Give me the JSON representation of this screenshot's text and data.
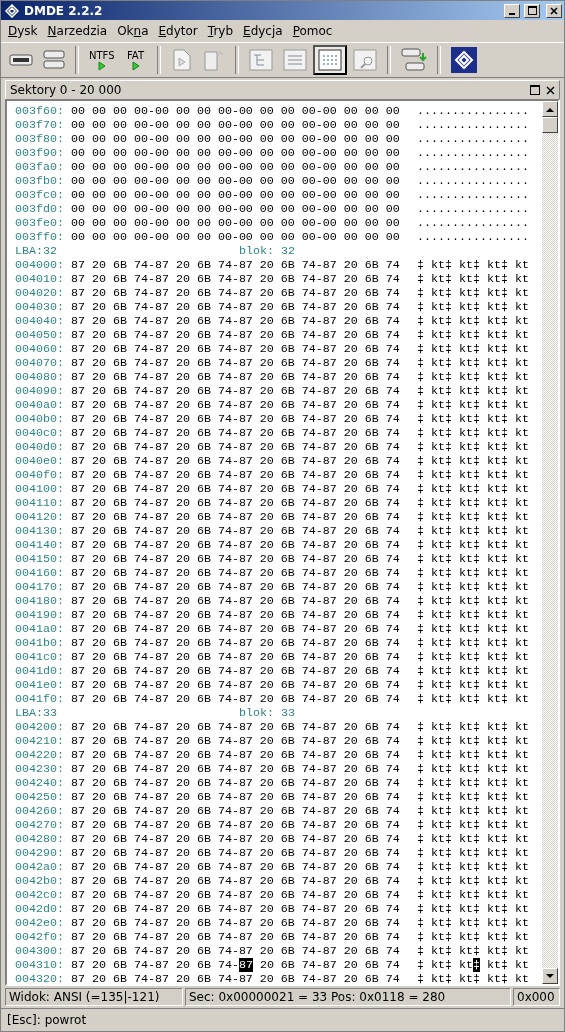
{
  "window": {
    "title": "DMDE 2.2.2"
  },
  "menu": [
    {
      "key": "D",
      "post": "ysk"
    },
    {
      "key": "N",
      "post": "arzedzia"
    },
    {
      "pre": "Ok",
      "key": "n",
      "post": "a"
    },
    {
      "key": "E",
      "post": "dytor"
    },
    {
      "key": "T",
      "post": "ryb"
    },
    {
      "key": "E",
      "post": "dycja"
    },
    {
      "key": "P",
      "post": "omoc"
    }
  ],
  "toolbar": [
    {
      "kind": "drive",
      "selected": false
    },
    {
      "kind": "drives",
      "selected": false
    },
    {
      "kind": "sep"
    },
    {
      "kind": "fs",
      "label": "NTFS",
      "selected": false
    },
    {
      "kind": "fs",
      "label": "FAT",
      "selected": false
    },
    {
      "kind": "sep"
    },
    {
      "kind": "doc",
      "selected": false
    },
    {
      "kind": "docnew",
      "selected": false
    },
    {
      "kind": "sep"
    },
    {
      "kind": "tree",
      "selected": false
    },
    {
      "kind": "list",
      "selected": false
    },
    {
      "kind": "grid",
      "selected": true
    },
    {
      "kind": "find",
      "selected": false
    },
    {
      "kind": "sep"
    },
    {
      "kind": "copy",
      "selected": false
    },
    {
      "kind": "sep"
    },
    {
      "kind": "logo",
      "selected": false
    }
  ],
  "pane": {
    "title": "Sektory 0 - 20 000"
  },
  "rows": [
    {
      "kind": "hex",
      "address": "003f60:",
      "hex": [
        {
          "text": "00 00 00 00-00 00 00 00-00 00 00 00-00 00 00 00",
          "selected": false
        }
      ],
      "ascii": [
        {
          "text": "................",
          "selected": false
        }
      ]
    },
    {
      "kind": "hex",
      "address": "003f70:",
      "hex": [
        {
          "text": "00 00 00 00-00 00 00 00-00 00 00 00-00 00 00 00",
          "selected": false
        }
      ],
      "ascii": [
        {
          "text": "................",
          "selected": false
        }
      ]
    },
    {
      "kind": "hex",
      "address": "003f80:",
      "hex": [
        {
          "text": "00 00 00 00-00 00 00 00-00 00 00 00-00 00 00 00",
          "selected": false
        }
      ],
      "ascii": [
        {
          "text": "................",
          "selected": false
        }
      ]
    },
    {
      "kind": "hex",
      "address": "003f90:",
      "hex": [
        {
          "text": "00 00 00 00-00 00 00 00-00 00 00 00-00 00 00 00",
          "selected": false
        }
      ],
      "ascii": [
        {
          "text": "................",
          "selected": false
        }
      ]
    },
    {
      "kind": "hex",
      "address": "003fa0:",
      "hex": [
        {
          "text": "00 00 00 00-00 00 00 00-00 00 00 00-00 00 00 00",
          "selected": false
        }
      ],
      "ascii": [
        {
          "text": "................",
          "selected": false
        }
      ]
    },
    {
      "kind": "hex",
      "address": "003fb0:",
      "hex": [
        {
          "text": "00 00 00 00-00 00 00 00-00 00 00 00-00 00 00 00",
          "selected": false
        }
      ],
      "ascii": [
        {
          "text": "................",
          "selected": false
        }
      ]
    },
    {
      "kind": "hex",
      "address": "003fc0:",
      "hex": [
        {
          "text": "00 00 00 00-00 00 00 00-00 00 00 00-00 00 00 00",
          "selected": false
        }
      ],
      "ascii": [
        {
          "text": "................",
          "selected": false
        }
      ]
    },
    {
      "kind": "hex",
      "address": "003fd0:",
      "hex": [
        {
          "text": "00 00 00 00-00 00 00 00-00 00 00 00-00 00 00 00",
          "selected": false
        }
      ],
      "ascii": [
        {
          "text": "................",
          "selected": false
        }
      ]
    },
    {
      "kind": "hex",
      "address": "003fe0:",
      "hex": [
        {
          "text": "00 00 00 00-00 00 00 00-00 00 00 00-00 00 00 00",
          "selected": false
        }
      ],
      "ascii": [
        {
          "text": "................",
          "selected": false
        }
      ]
    },
    {
      "kind": "hex",
      "address": "003ff0:",
      "hex": [
        {
          "text": "00 00 00 00-00 00 00 00-00 00 00 00-00 00 00 00",
          "selected": false
        }
      ],
      "ascii": [
        {
          "text": "................",
          "selected": false
        }
      ]
    },
    {
      "kind": "sector",
      "lba": "LBA:32",
      "block": "blok: 32"
    },
    {
      "kind": "hex",
      "address": "004000:",
      "hex": [
        {
          "text": "87 20 6B 74-87 20 6B 74-87 20 6B 74-87 20 6B 74",
          "selected": false
        }
      ],
      "ascii": [
        {
          "text": "‡ kt‡ kt‡ kt‡ kt",
          "selected": false
        }
      ]
    },
    {
      "kind": "hex",
      "address": "004010:",
      "hex": [
        {
          "text": "87 20 6B 74-87 20 6B 74-87 20 6B 74-87 20 6B 74",
          "selected": false
        }
      ],
      "ascii": [
        {
          "text": "‡ kt‡ kt‡ kt‡ kt",
          "selected": false
        }
      ]
    },
    {
      "kind": "hex",
      "address": "004020:",
      "hex": [
        {
          "text": "87 20 6B 74-87 20 6B 74-87 20 6B 74-87 20 6B 74",
          "selected": false
        }
      ],
      "ascii": [
        {
          "text": "‡ kt‡ kt‡ kt‡ kt",
          "selected": false
        }
      ]
    },
    {
      "kind": "hex",
      "address": "004030:",
      "hex": [
        {
          "text": "87 20 6B 74-87 20 6B 74-87 20 6B 74-87 20 6B 74",
          "selected": false
        }
      ],
      "ascii": [
        {
          "text": "‡ kt‡ kt‡ kt‡ kt",
          "selected": false
        }
      ]
    },
    {
      "kind": "hex",
      "address": "004040:",
      "hex": [
        {
          "text": "87 20 6B 74-87 20 6B 74-87 20 6B 74-87 20 6B 74",
          "selected": false
        }
      ],
      "ascii": [
        {
          "text": "‡ kt‡ kt‡ kt‡ kt",
          "selected": false
        }
      ]
    },
    {
      "kind": "hex",
      "address": "004050:",
      "hex": [
        {
          "text": "87 20 6B 74-87 20 6B 74-87 20 6B 74-87 20 6B 74",
          "selected": false
        }
      ],
      "ascii": [
        {
          "text": "‡ kt‡ kt‡ kt‡ kt",
          "selected": false
        }
      ]
    },
    {
      "kind": "hex",
      "address": "004060:",
      "hex": [
        {
          "text": "87 20 6B 74-87 20 6B 74-87 20 6B 74-87 20 6B 74",
          "selected": false
        }
      ],
      "ascii": [
        {
          "text": "‡ kt‡ kt‡ kt‡ kt",
          "selected": false
        }
      ]
    },
    {
      "kind": "hex",
      "address": "004070:",
      "hex": [
        {
          "text": "87 20 6B 74-87 20 6B 74-87 20 6B 74-87 20 6B 74",
          "selected": false
        }
      ],
      "ascii": [
        {
          "text": "‡ kt‡ kt‡ kt‡ kt",
          "selected": false
        }
      ]
    },
    {
      "kind": "hex",
      "address": "004080:",
      "hex": [
        {
          "text": "87 20 6B 74-87 20 6B 74-87 20 6B 74-87 20 6B 74",
          "selected": false
        }
      ],
      "ascii": [
        {
          "text": "‡ kt‡ kt‡ kt‡ kt",
          "selected": false
        }
      ]
    },
    {
      "kind": "hex",
      "address": "004090:",
      "hex": [
        {
          "text": "87 20 6B 74-87 20 6B 74-87 20 6B 74-87 20 6B 74",
          "selected": false
        }
      ],
      "ascii": [
        {
          "text": "‡ kt‡ kt‡ kt‡ kt",
          "selected": false
        }
      ]
    },
    {
      "kind": "hex",
      "address": "0040a0:",
      "hex": [
        {
          "text": "87 20 6B 74-87 20 6B 74-87 20 6B 74-87 20 6B 74",
          "selected": false
        }
      ],
      "ascii": [
        {
          "text": "‡ kt‡ kt‡ kt‡ kt",
          "selected": false
        }
      ]
    },
    {
      "kind": "hex",
      "address": "0040b0:",
      "hex": [
        {
          "text": "87 20 6B 74-87 20 6B 74-87 20 6B 74-87 20 6B 74",
          "selected": false
        }
      ],
      "ascii": [
        {
          "text": "‡ kt‡ kt‡ kt‡ kt",
          "selected": false
        }
      ]
    },
    {
      "kind": "hex",
      "address": "0040c0:",
      "hex": [
        {
          "text": "87 20 6B 74-87 20 6B 74-87 20 6B 74-87 20 6B 74",
          "selected": false
        }
      ],
      "ascii": [
        {
          "text": "‡ kt‡ kt‡ kt‡ kt",
          "selected": false
        }
      ]
    },
    {
      "kind": "hex",
      "address": "0040d0:",
      "hex": [
        {
          "text": "87 20 6B 74-87 20 6B 74-87 20 6B 74-87 20 6B 74",
          "selected": false
        }
      ],
      "ascii": [
        {
          "text": "‡ kt‡ kt‡ kt‡ kt",
          "selected": false
        }
      ]
    },
    {
      "kind": "hex",
      "address": "0040e0:",
      "hex": [
        {
          "text": "87 20 6B 74-87 20 6B 74-87 20 6B 74-87 20 6B 74",
          "selected": false
        }
      ],
      "ascii": [
        {
          "text": "‡ kt‡ kt‡ kt‡ kt",
          "selected": false
        }
      ]
    },
    {
      "kind": "hex",
      "address": "0040f0:",
      "hex": [
        {
          "text": "87 20 6B 74-87 20 6B 74-87 20 6B 74-87 20 6B 74",
          "selected": false
        }
      ],
      "ascii": [
        {
          "text": "‡ kt‡ kt‡ kt‡ kt",
          "selected": false
        }
      ]
    },
    {
      "kind": "hex",
      "address": "004100:",
      "hex": [
        {
          "text": "87 20 6B 74-87 20 6B 74-87 20 6B 74-87 20 6B 74",
          "selected": false
        }
      ],
      "ascii": [
        {
          "text": "‡ kt‡ kt‡ kt‡ kt",
          "selected": false
        }
      ]
    },
    {
      "kind": "hex",
      "address": "004110:",
      "hex": [
        {
          "text": "87 20 6B 74-87 20 6B 74-87 20 6B 74-87 20 6B 74",
          "selected": false
        }
      ],
      "ascii": [
        {
          "text": "‡ kt‡ kt‡ kt‡ kt",
          "selected": false
        }
      ]
    },
    {
      "kind": "hex",
      "address": "004120:",
      "hex": [
        {
          "text": "87 20 6B 74-87 20 6B 74-87 20 6B 74-87 20 6B 74",
          "selected": false
        }
      ],
      "ascii": [
        {
          "text": "‡ kt‡ kt‡ kt‡ kt",
          "selected": false
        }
      ]
    },
    {
      "kind": "hex",
      "address": "004130:",
      "hex": [
        {
          "text": "87 20 6B 74-87 20 6B 74-87 20 6B 74-87 20 6B 74",
          "selected": false
        }
      ],
      "ascii": [
        {
          "text": "‡ kt‡ kt‡ kt‡ kt",
          "selected": false
        }
      ]
    },
    {
      "kind": "hex",
      "address": "004140:",
      "hex": [
        {
          "text": "87 20 6B 74-87 20 6B 74-87 20 6B 74-87 20 6B 74",
          "selected": false
        }
      ],
      "ascii": [
        {
          "text": "‡ kt‡ kt‡ kt‡ kt",
          "selected": false
        }
      ]
    },
    {
      "kind": "hex",
      "address": "004150:",
      "hex": [
        {
          "text": "87 20 6B 74-87 20 6B 74-87 20 6B 74-87 20 6B 74",
          "selected": false
        }
      ],
      "ascii": [
        {
          "text": "‡ kt‡ kt‡ kt‡ kt",
          "selected": false
        }
      ]
    },
    {
      "kind": "hex",
      "address": "004160:",
      "hex": [
        {
          "text": "87 20 6B 74-87 20 6B 74-87 20 6B 74-87 20 6B 74",
          "selected": false
        }
      ],
      "ascii": [
        {
          "text": "‡ kt‡ kt‡ kt‡ kt",
          "selected": false
        }
      ]
    },
    {
      "kind": "hex",
      "address": "004170:",
      "hex": [
        {
          "text": "87 20 6B 74-87 20 6B 74-87 20 6B 74-87 20 6B 74",
          "selected": false
        }
      ],
      "ascii": [
        {
          "text": "‡ kt‡ kt‡ kt‡ kt",
          "selected": false
        }
      ]
    },
    {
      "kind": "hex",
      "address": "004180:",
      "hex": [
        {
          "text": "87 20 6B 74-87 20 6B 74-87 20 6B 74-87 20 6B 74",
          "selected": false
        }
      ],
      "ascii": [
        {
          "text": "‡ kt‡ kt‡ kt‡ kt",
          "selected": false
        }
      ]
    },
    {
      "kind": "hex",
      "address": "004190:",
      "hex": [
        {
          "text": "87 20 6B 74-87 20 6B 74-87 20 6B 74-87 20 6B 74",
          "selected": false
        }
      ],
      "ascii": [
        {
          "text": "‡ kt‡ kt‡ kt‡ kt",
          "selected": false
        }
      ]
    },
    {
      "kind": "hex",
      "address": "0041a0:",
      "hex": [
        {
          "text": "87 20 6B 74-87 20 6B 74-87 20 6B 74-87 20 6B 74",
          "selected": false
        }
      ],
      "ascii": [
        {
          "text": "‡ kt‡ kt‡ kt‡ kt",
          "selected": false
        }
      ]
    },
    {
      "kind": "hex",
      "address": "0041b0:",
      "hex": [
        {
          "text": "87 20 6B 74-87 20 6B 74-87 20 6B 74-87 20 6B 74",
          "selected": false
        }
      ],
      "ascii": [
        {
          "text": "‡ kt‡ kt‡ kt‡ kt",
          "selected": false
        }
      ]
    },
    {
      "kind": "hex",
      "address": "0041c0:",
      "hex": [
        {
          "text": "87 20 6B 74-87 20 6B 74-87 20 6B 74-87 20 6B 74",
          "selected": false
        }
      ],
      "ascii": [
        {
          "text": "‡ kt‡ kt‡ kt‡ kt",
          "selected": false
        }
      ]
    },
    {
      "kind": "hex",
      "address": "0041d0:",
      "hex": [
        {
          "text": "87 20 6B 74-87 20 6B 74-87 20 6B 74-87 20 6B 74",
          "selected": false
        }
      ],
      "ascii": [
        {
          "text": "‡ kt‡ kt‡ kt‡ kt",
          "selected": false
        }
      ]
    },
    {
      "kind": "hex",
      "address": "0041e0:",
      "hex": [
        {
          "text": "87 20 6B 74-87 20 6B 74-87 20 6B 74-87 20 6B 74",
          "selected": false
        }
      ],
      "ascii": [
        {
          "text": "‡ kt‡ kt‡ kt‡ kt",
          "selected": false
        }
      ]
    },
    {
      "kind": "hex",
      "address": "0041f0:",
      "hex": [
        {
          "text": "87 20 6B 74-87 20 6B 74-87 20 6B 74-87 20 6B 74",
          "selected": false
        }
      ],
      "ascii": [
        {
          "text": "‡ kt‡ kt‡ kt‡ kt",
          "selected": false
        }
      ]
    },
    {
      "kind": "sector",
      "lba": "LBA:33",
      "block": "blok: 33"
    },
    {
      "kind": "hex",
      "address": "004200:",
      "hex": [
        {
          "text": "87 20 6B 74-87 20 6B 74-87 20 6B 74-87 20 6B 74",
          "selected": false
        }
      ],
      "ascii": [
        {
          "text": "‡ kt‡ kt‡ kt‡ kt",
          "selected": false
        }
      ]
    },
    {
      "kind": "hex",
      "address": "004210:",
      "hex": [
        {
          "text": "87 20 6B 74-87 20 6B 74-87 20 6B 74-87 20 6B 74",
          "selected": false
        }
      ],
      "ascii": [
        {
          "text": "‡ kt‡ kt‡ kt‡ kt",
          "selected": false
        }
      ]
    },
    {
      "kind": "hex",
      "address": "004220:",
      "hex": [
        {
          "text": "87 20 6B 74-87 20 6B 74-87 20 6B 74-87 20 6B 74",
          "selected": false
        }
      ],
      "ascii": [
        {
          "text": "‡ kt‡ kt‡ kt‡ kt",
          "selected": false
        }
      ]
    },
    {
      "kind": "hex",
      "address": "004230:",
      "hex": [
        {
          "text": "87 20 6B 74-87 20 6B 74-87 20 6B 74-87 20 6B 74",
          "selected": false
        }
      ],
      "ascii": [
        {
          "text": "‡ kt‡ kt‡ kt‡ kt",
          "selected": false
        }
      ]
    },
    {
      "kind": "hex",
      "address": "004240:",
      "hex": [
        {
          "text": "87 20 6B 74-87 20 6B 74-87 20 6B 74-87 20 6B 74",
          "selected": false
        }
      ],
      "ascii": [
        {
          "text": "‡ kt‡ kt‡ kt‡ kt",
          "selected": false
        }
      ]
    },
    {
      "kind": "hex",
      "address": "004250:",
      "hex": [
        {
          "text": "87 20 6B 74-87 20 6B 74-87 20 6B 74-87 20 6B 74",
          "selected": false
        }
      ],
      "ascii": [
        {
          "text": "‡ kt‡ kt‡ kt‡ kt",
          "selected": false
        }
      ]
    },
    {
      "kind": "hex",
      "address": "004260:",
      "hex": [
        {
          "text": "87 20 6B 74-87 20 6B 74-87 20 6B 74-87 20 6B 74",
          "selected": false
        }
      ],
      "ascii": [
        {
          "text": "‡ kt‡ kt‡ kt‡ kt",
          "selected": false
        }
      ]
    },
    {
      "kind": "hex",
      "address": "004270:",
      "hex": [
        {
          "text": "87 20 6B 74-87 20 6B 74-87 20 6B 74-87 20 6B 74",
          "selected": false
        }
      ],
      "ascii": [
        {
          "text": "‡ kt‡ kt‡ kt‡ kt",
          "selected": false
        }
      ]
    },
    {
      "kind": "hex",
      "address": "004280:",
      "hex": [
        {
          "text": "87 20 6B 74-87 20 6B 74-87 20 6B 74-87 20 6B 74",
          "selected": false
        }
      ],
      "ascii": [
        {
          "text": "‡ kt‡ kt‡ kt‡ kt",
          "selected": false
        }
      ]
    },
    {
      "kind": "hex",
      "address": "004290:",
      "hex": [
        {
          "text": "87 20 6B 74-87 20 6B 74-87 20 6B 74-87 20 6B 74",
          "selected": false
        }
      ],
      "ascii": [
        {
          "text": "‡ kt‡ kt‡ kt‡ kt",
          "selected": false
        }
      ]
    },
    {
      "kind": "hex",
      "address": "0042a0:",
      "hex": [
        {
          "text": "87 20 6B 74-87 20 6B 74-87 20 6B 74-87 20 6B 74",
          "selected": false
        }
      ],
      "ascii": [
        {
          "text": "‡ kt‡ kt‡ kt‡ kt",
          "selected": false
        }
      ]
    },
    {
      "kind": "hex",
      "address": "0042b0:",
      "hex": [
        {
          "text": "87 20 6B 74-87 20 6B 74-87 20 6B 74-87 20 6B 74",
          "selected": false
        }
      ],
      "ascii": [
        {
          "text": "‡ kt‡ kt‡ kt‡ kt",
          "selected": false
        }
      ]
    },
    {
      "kind": "hex",
      "address": "0042c0:",
      "hex": [
        {
          "text": "87 20 6B 74-87 20 6B 74-87 20 6B 74-87 20 6B 74",
          "selected": false
        }
      ],
      "ascii": [
        {
          "text": "‡ kt‡ kt‡ kt‡ kt",
          "selected": false
        }
      ]
    },
    {
      "kind": "hex",
      "address": "0042d0:",
      "hex": [
        {
          "text": "87 20 6B 74-87 20 6B 74-87 20 6B 74-87 20 6B 74",
          "selected": false
        }
      ],
      "ascii": [
        {
          "text": "‡ kt‡ kt‡ kt‡ kt",
          "selected": false
        }
      ]
    },
    {
      "kind": "hex",
      "address": "0042e0:",
      "hex": [
        {
          "text": "87 20 6B 74-87 20 6B 74-87 20 6B 74-87 20 6B 74",
          "selected": false
        }
      ],
      "ascii": [
        {
          "text": "‡ kt‡ kt‡ kt‡ kt",
          "selected": false
        }
      ]
    },
    {
      "kind": "hex",
      "address": "0042f0:",
      "hex": [
        {
          "text": "87 20 6B 74-87 20 6B 74-87 20 6B 74-87 20 6B 74",
          "selected": false
        }
      ],
      "ascii": [
        {
          "text": "‡ kt‡ kt‡ kt‡ kt",
          "selected": false
        }
      ]
    },
    {
      "kind": "hex",
      "address": "004300:",
      "hex": [
        {
          "text": "87 20 6B 74-87 20 6B 74-87 20 6B 74-87 20 6B 74",
          "selected": false
        }
      ],
      "ascii": [
        {
          "text": "‡ kt‡ kt‡ kt‡ kt",
          "selected": false
        }
      ]
    },
    {
      "kind": "hex",
      "address": "004310:",
      "hex": [
        {
          "text": "87 20 6B 74-87 20 6B 74-",
          "selected": false
        },
        {
          "text": "87",
          "selected": true
        },
        {
          "text": " 20 6B 74-87 20 6B 74",
          "selected": false
        }
      ],
      "ascii": [
        {
          "text": "‡ kt‡ kt",
          "selected": false
        },
        {
          "text": "‡",
          "selected": true
        },
        {
          "text": " kt‡ kt",
          "selected": false
        }
      ]
    },
    {
      "kind": "hex",
      "address": "004320:",
      "hex": [
        {
          "text": "87 20 6B 74-87 20 6B 74-87 20 6B 74-87 20 6B 74",
          "selected": false
        }
      ],
      "ascii": [
        {
          "text": "‡ kt‡ kt‡ kt‡ kt",
          "selected": false
        }
      ]
    }
  ],
  "status_bar": [
    "Widok: ANSI (=135|-121)",
    "Sec: 0x00000021 = 33  Pos: 0x0118 = 280",
    "0x000"
  ],
  "hint_bar": "[Esc]: powrot"
}
